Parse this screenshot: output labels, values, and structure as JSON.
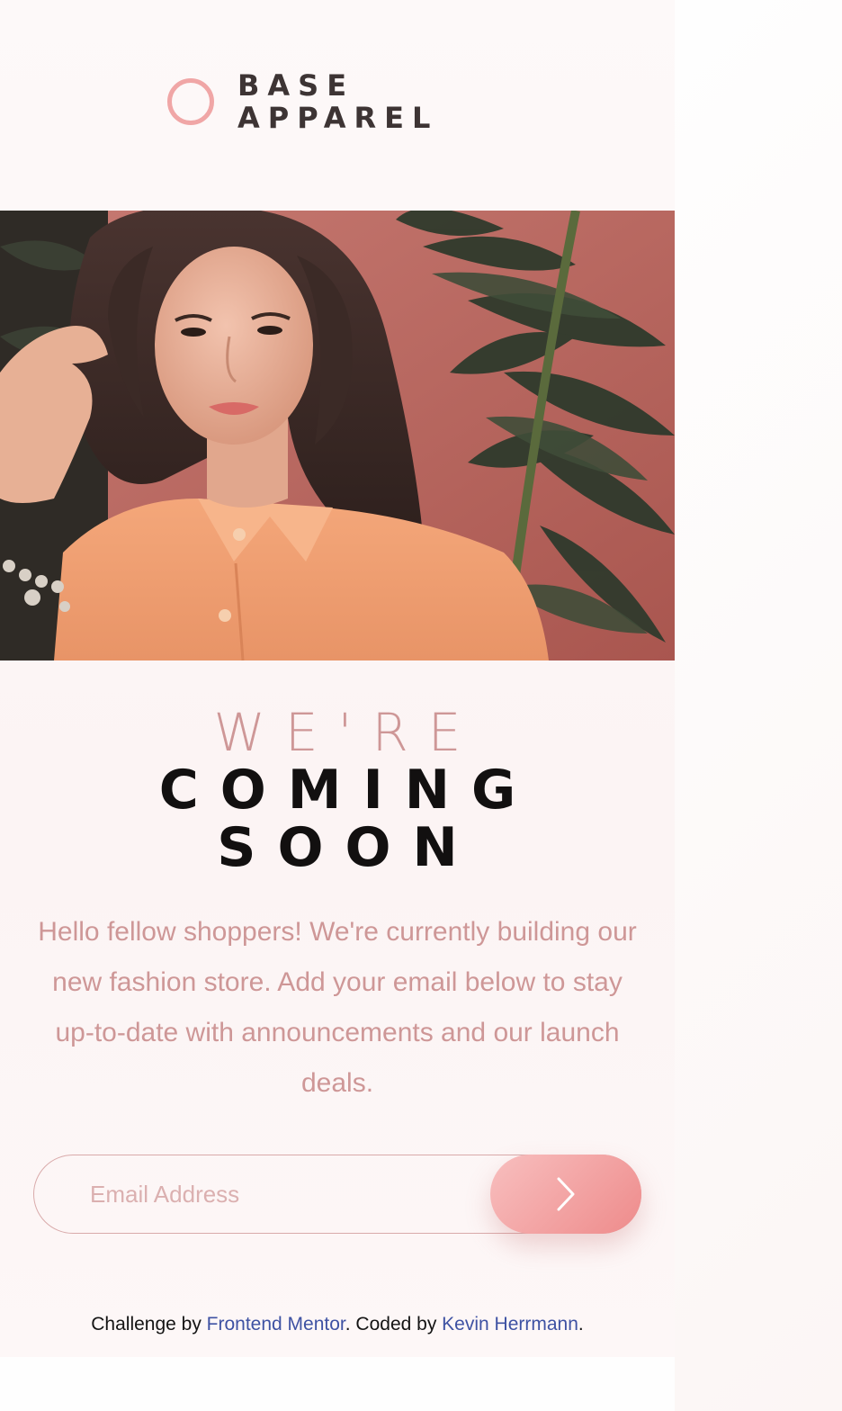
{
  "brand": {
    "logo_icon": "ring-icon",
    "line1": "BASE",
    "line2": "APPAREL",
    "accent_color": "#f0a6a6"
  },
  "hero": {
    "image": "hero-photo"
  },
  "headline": {
    "line1": "WE'RE",
    "line2": "COMING",
    "line3": "SOON"
  },
  "description": "Hello fellow shoppers! We're currently building our new fashion store. Add your email below to stay up-to-date with announcements and our launch deals.",
  "form": {
    "email_placeholder": "Email Address",
    "submit_icon": "chevron-right-icon"
  },
  "footer": {
    "prefix": "Challenge by ",
    "link1": "Frontend Mentor",
    "middle": ". Coded by ",
    "link2": "Kevin Herrmann",
    "suffix": ".",
    "link_color": "#3e52a3"
  },
  "colors": {
    "primary_text": "#ce9797",
    "dark_text": "#121010",
    "button_gradient_start": "#f8bfbf",
    "button_gradient_end": "#ee8b8b"
  }
}
